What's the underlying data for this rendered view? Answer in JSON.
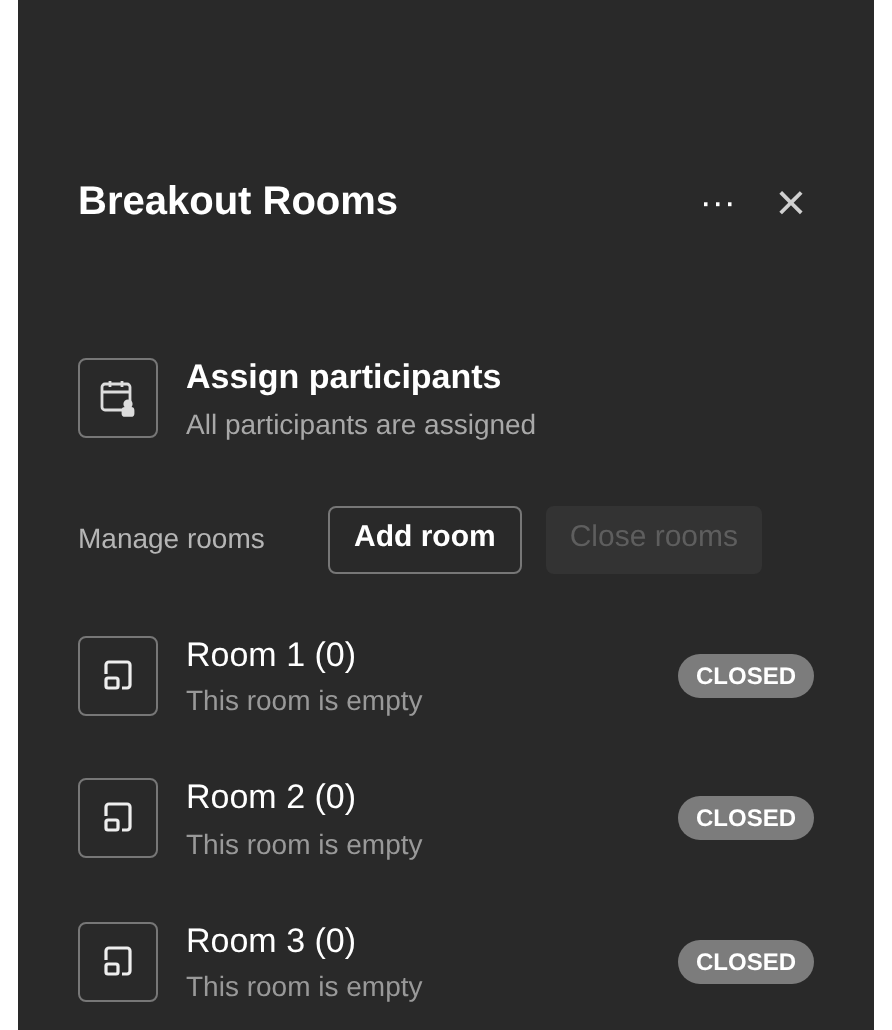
{
  "panel": {
    "title": "Breakout Rooms",
    "more_icon": "···",
    "close_icon": "×"
  },
  "assign": {
    "title": "Assign participants",
    "subtitle": "All participants are assigned"
  },
  "manage": {
    "label": "Manage rooms",
    "buttons": [
      {
        "label": "Add room",
        "disabled": false
      },
      {
        "label": "Close rooms",
        "disabled": true
      }
    ]
  },
  "rooms": [
    {
      "name": "Room 1 (0)",
      "subtitle": "This room is empty",
      "status": "CLOSED"
    },
    {
      "name": "Room 2 (0)",
      "subtitle": "This room is empty",
      "status": "CLOSED"
    },
    {
      "name": "Room 3 (0)",
      "subtitle": "This room is empty",
      "status": "CLOSED"
    }
  ]
}
